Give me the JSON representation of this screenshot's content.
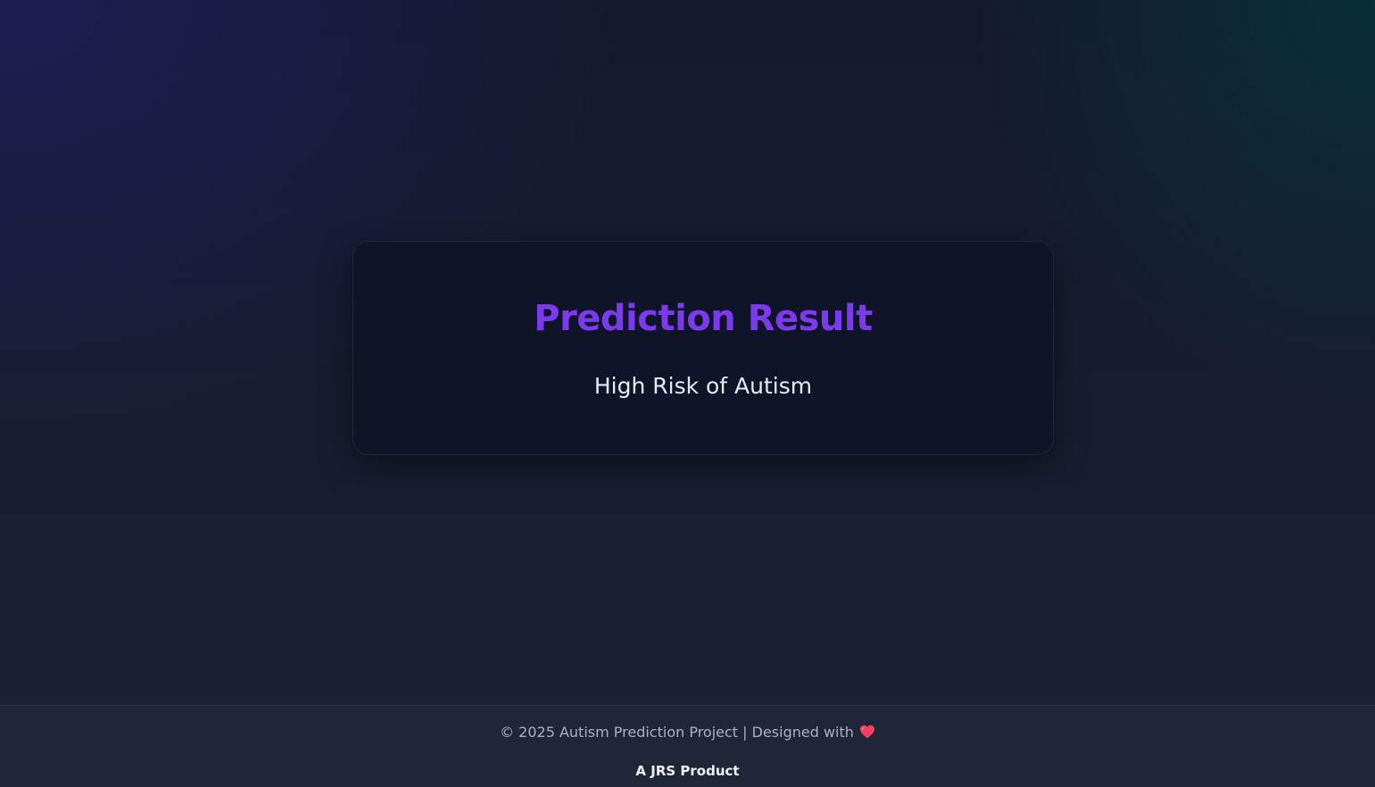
{
  "card": {
    "title": "Prediction Result",
    "result": "High Risk of Autism"
  },
  "footer": {
    "copyright": "© 2025 Autism Prediction Project | Designed with",
    "heart_icon": "heart-icon",
    "brand": "A JRS Product"
  },
  "colors": {
    "accent": "#7c3aed",
    "heart": "#f43f5e"
  }
}
